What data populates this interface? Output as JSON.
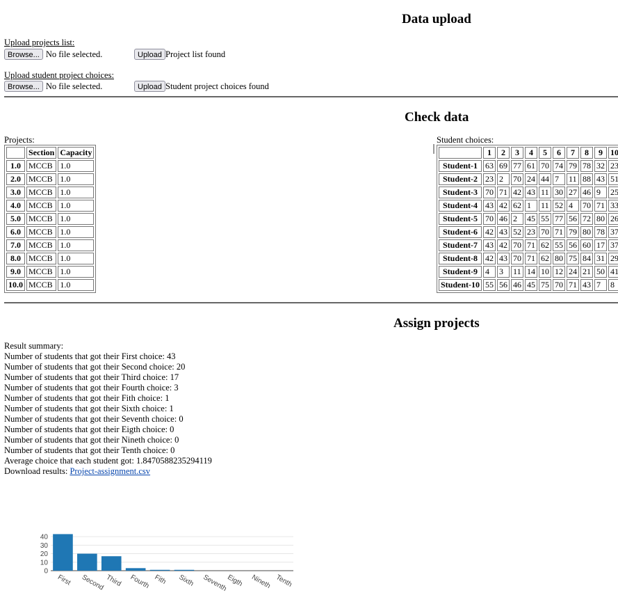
{
  "upload": {
    "title": "Data upload",
    "projects_label": "Upload projects list:",
    "browse_label": "Browse...",
    "no_file": "No file selected.",
    "upload_label": "Upload",
    "projects_status": "Project list found",
    "choices_label": "Upload student project choices:",
    "choices_status": "Student project choices found"
  },
  "check": {
    "title": "Check data",
    "projects_caption": "Projects:",
    "projects_headers": [
      "",
      "Section",
      "Capacity"
    ],
    "projects_rows": [
      [
        "1.0",
        "MCCB",
        "1.0"
      ],
      [
        "2.0",
        "MCCB",
        "1.0"
      ],
      [
        "3.0",
        "MCCB",
        "1.0"
      ],
      [
        "4.0",
        "MCCB",
        "1.0"
      ],
      [
        "5.0",
        "MCCB",
        "1.0"
      ],
      [
        "6.0",
        "MCCB",
        "1.0"
      ],
      [
        "7.0",
        "MCCB",
        "1.0"
      ],
      [
        "8.0",
        "MCCB",
        "1.0"
      ],
      [
        "9.0",
        "MCCB",
        "1.0"
      ],
      [
        "10.0",
        "MCCB",
        "1.0"
      ]
    ],
    "choices_caption": "Student choices:",
    "choices_headers": [
      "",
      "1",
      "2",
      "3",
      "4",
      "5",
      "6",
      "7",
      "8",
      "9",
      "10"
    ],
    "choices_rows": [
      [
        "Student-1",
        "63",
        "69",
        "77",
        "61",
        "70",
        "74",
        "79",
        "78",
        "32",
        "23"
      ],
      [
        "Student-2",
        "23",
        "2",
        "70",
        "24",
        "44",
        "7",
        "11",
        "88",
        "43",
        "51"
      ],
      [
        "Student-3",
        "70",
        "71",
        "42",
        "43",
        "11",
        "30",
        "27",
        "46",
        "9",
        "25"
      ],
      [
        "Student-4",
        "43",
        "42",
        "62",
        "1",
        "11",
        "52",
        "4",
        "70",
        "71",
        "33"
      ],
      [
        "Student-5",
        "70",
        "46",
        "2",
        "45",
        "55",
        "77",
        "56",
        "72",
        "80",
        "26"
      ],
      [
        "Student-6",
        "42",
        "43",
        "52",
        "23",
        "70",
        "71",
        "79",
        "80",
        "78",
        "37"
      ],
      [
        "Student-7",
        "43",
        "42",
        "70",
        "71",
        "62",
        "55",
        "56",
        "60",
        "17",
        "37"
      ],
      [
        "Student-8",
        "42",
        "43",
        "70",
        "71",
        "62",
        "80",
        "75",
        "84",
        "31",
        "29"
      ],
      [
        "Student-9",
        "4",
        "3",
        "11",
        "14",
        "10",
        "12",
        "24",
        "21",
        "50",
        "41"
      ],
      [
        "Student-10",
        "55",
        "56",
        "46",
        "45",
        "75",
        "70",
        "71",
        "43",
        "7",
        "8"
      ]
    ]
  },
  "assign": {
    "title": "Assign projects",
    "summary_heading": "Result summary:",
    "lines": [
      "Number of students that got their First choice: 43",
      "Number of students that got their Second choice: 20",
      "Number of students that got their Third choice: 17",
      "Number of students that got their Fourth choice: 3",
      "Number of students that got their Fith choice: 1",
      "Number of students that got their Sixth choice: 1",
      "Number of students that got their Seventh choice: 0",
      "Number of students that got their Eigth choice: 0",
      "Number of students that got their Nineth choice: 0",
      "Number of students that got their Tenth choice: 0",
      "Average choice that each student got: 1.8470588235294119"
    ],
    "download_label": "Download results:",
    "download_link": "Project-assignment.csv"
  },
  "chart_data": {
    "type": "bar",
    "categories": [
      "First",
      "Second",
      "Third",
      "Fourth",
      "Fith",
      "Sixth",
      "Seventh",
      "Eigth",
      "Nineth",
      "Tenth"
    ],
    "values": [
      43,
      20,
      17,
      3,
      1,
      1,
      0,
      0,
      0,
      0
    ],
    "yticks": [
      "0",
      "10",
      "20",
      "30",
      "40"
    ],
    "ylim": [
      0,
      45
    ],
    "bar_color": "#1f77b4",
    "grid": true,
    "title": "",
    "xlabel": "",
    "ylabel": ""
  }
}
